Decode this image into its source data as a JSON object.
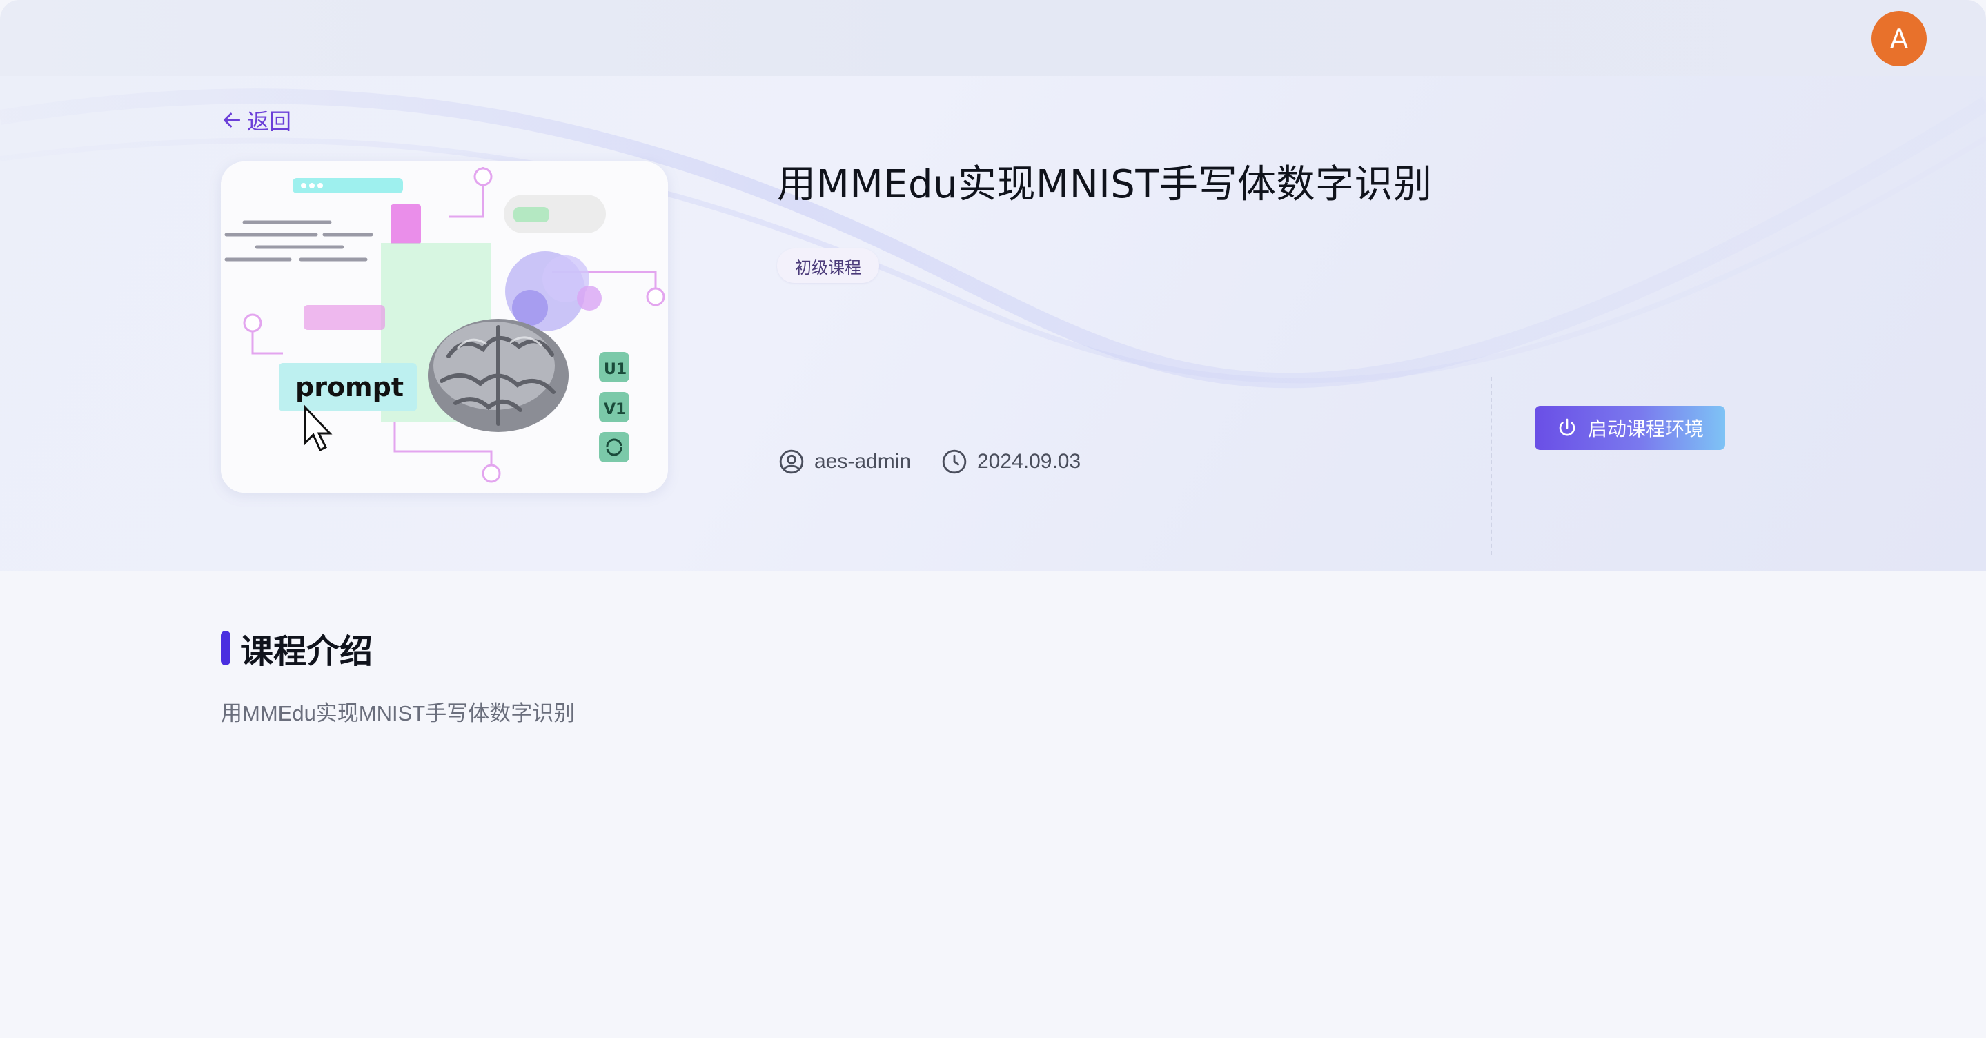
{
  "header": {
    "avatar_letter": "A",
    "avatar_color": "#e8712b"
  },
  "nav": {
    "back_label": "返回"
  },
  "course": {
    "title": "用MMEdu实现MNIST手写体数字识别",
    "level_tag": "初级课程",
    "author": "aes-admin",
    "date": "2024.09.03",
    "cover": {
      "prompt_text": "prompt",
      "badges": [
        "U1",
        "V1"
      ]
    }
  },
  "actions": {
    "start_label": "启动课程环境",
    "accent": "#6a4fe6"
  },
  "intro": {
    "heading": "课程介绍",
    "body": "用MMEdu实现MNIST手写体数字识别"
  },
  "icons": {
    "back": "arrow-left-icon",
    "author": "user-circle-icon",
    "date": "clock-icon",
    "start": "power-icon"
  }
}
